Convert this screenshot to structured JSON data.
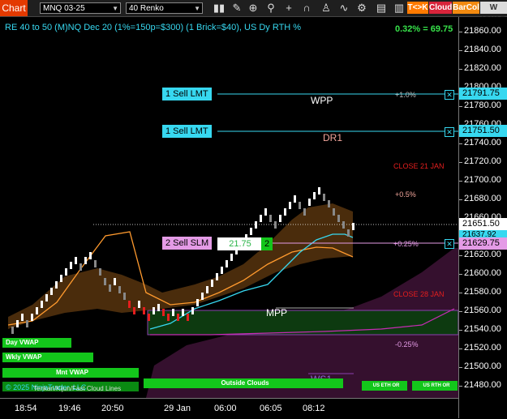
{
  "toolbar": {
    "chart_label": "Chart",
    "instrument": "MNQ 03-25",
    "bar_type": "40 Renko",
    "icons": [
      "bar-style-icon",
      "draw-icon",
      "zoom-icon",
      "search-icon",
      "crosshair-icon",
      "magnet-icon",
      "strategies-icon",
      "indicators-icon",
      "properties-icon",
      "data-box-icon",
      "chart-trader-icon"
    ],
    "tk_label": "T<>K",
    "cloud_label": "Cloud",
    "barcol_label": "BarCol",
    "vwap_label": "W VWAP"
  },
  "chart": {
    "header": "RE 40 to 50 (M)NQ Dec 20 (1%=150p=$300) (1 Brick=$40), US Dy RTH %",
    "pct_change": "0.32% = 69.75",
    "copyright": "© 2025 NinjaTrader, LLC",
    "indicator_caption": "Tenkan/Kijun/Fast Cloud Lines",
    "colors": {
      "accent": "#37d8f0",
      "sell_slm": "#e49be6",
      "up": "#ffffff",
      "down": "#888888",
      "red": "#e51e1e",
      "orange": "#ff9a2e",
      "band": "#4a2c0c",
      "green": "#13c61b",
      "purple": "#5a1d4f"
    }
  },
  "price_axis": {
    "ticks": [
      "21860.00",
      "21840.00",
      "21820.00",
      "21800.00",
      "21780.00",
      "21760.00",
      "21740.00",
      "21720.00",
      "21700.00",
      "21680.00",
      "21660.00",
      "21640.00",
      "21620.00",
      "21600.00",
      "21580.00",
      "21560.00",
      "21540.00",
      "21520.00",
      "21500.00",
      "21480.00"
    ],
    "current_price": "21651.50",
    "secondary_price": "21637.92",
    "lmt_price_1": "21791.75",
    "lmt_price_2": "21751.50",
    "slm_price": "21629.75"
  },
  "time_axis": [
    "18:54",
    "19:46",
    "20:50",
    "29 Jan",
    "06:00",
    "06:05",
    "08:12"
  ],
  "orders": {
    "sell_lmt_1": "1 Sell LMT",
    "sell_lmt_2": "1 Sell LMT",
    "sell_slm": "2 Sell SLM",
    "slm_pnl": "21.75",
    "slm_qty": "2"
  },
  "levels": {
    "wpp": "WPP",
    "dr1": "DR1",
    "mpp": "MPP",
    "ws1": "WS1",
    "close_21_jan": "CLOSE 21 JAN",
    "close_28_jan": "CLOSE 28 JAN",
    "pct_p1": "+1.0%",
    "pct_p05": "+0.5%",
    "pct_p025": "+0.25%",
    "pct_m025": "-0.25%"
  },
  "vwap_tags": {
    "day": "Day VWAP",
    "wkly": "Wkly VWAP",
    "mnt": "Mnt VWAP",
    "outside": "Outside Clouds",
    "us_eth_or_1": "US ETH OR",
    "us_rth_or": "US RTH OR"
  }
}
